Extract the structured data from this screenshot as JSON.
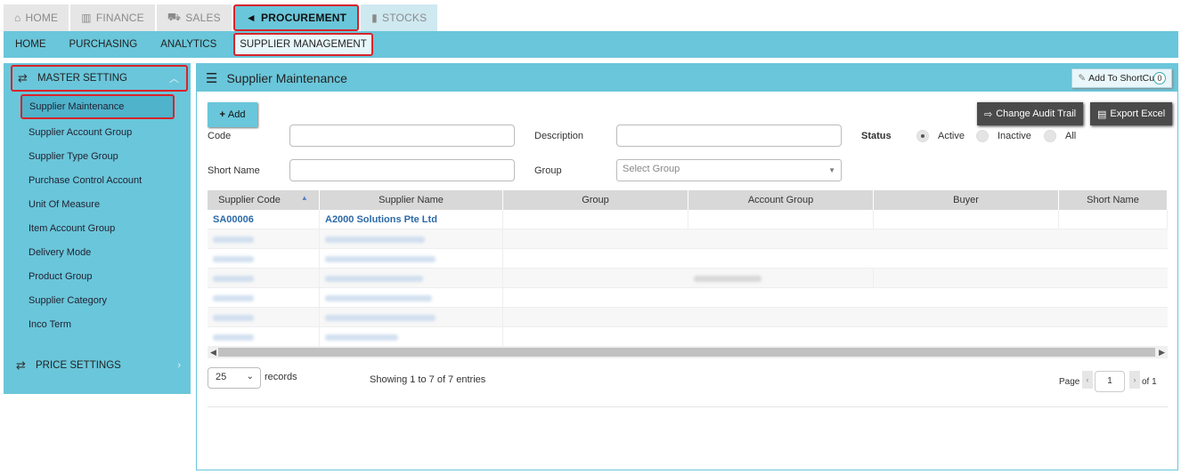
{
  "top_tabs": [
    {
      "label": "HOME",
      "icon": "home-icon",
      "glyph": "⌂"
    },
    {
      "label": "FINANCE",
      "icon": "bank-icon",
      "glyph": "🏛"
    },
    {
      "label": "SALES",
      "icon": "cart-icon",
      "glyph": "🛒"
    },
    {
      "label": "PROCUREMENT",
      "icon": "megaphone-icon",
      "glyph": "📢"
    },
    {
      "label": "STOCKS",
      "icon": "bar-chart-icon",
      "glyph": "▮"
    }
  ],
  "sub_nav": [
    "HOME",
    "PURCHASING",
    "ANALYTICS",
    "SUPPLIER MANAGEMENT"
  ],
  "sidebar": {
    "master_setting": "MASTER SETTING",
    "items": [
      "Supplier Maintenance",
      "Supplier Account Group",
      "Supplier Type Group",
      "Purchase Control Account",
      "Unit Of Measure",
      "Item Account Group",
      "Delivery Mode",
      "Product Group",
      "Supplier Category",
      "Inco Term"
    ],
    "price_settings": "PRICE SETTINGS"
  },
  "panel": {
    "title": "Supplier Maintenance",
    "shortcut_label": "Add To ShortCut",
    "shortcut_count": "0",
    "add_label": "Add",
    "audit_label": "Change Audit Trail",
    "export_label": "Export Excel"
  },
  "filters": {
    "code_label": "Code",
    "description_label": "Description",
    "status_label": "Status",
    "status_active": "Active",
    "status_inactive": "Inactive",
    "status_all": "All",
    "short_name_label": "Short Name",
    "group_label": "Group",
    "group_placeholder": "Select Group"
  },
  "table": {
    "columns": [
      "Supplier Code",
      "Supplier Name",
      "Group",
      "Account Group",
      "Buyer",
      "Short Name"
    ],
    "rows": [
      {
        "code": "SA00006",
        "name": "A2000 Solutions Pte Ltd"
      }
    ]
  },
  "footer": {
    "page_size": "25",
    "records_label": "records",
    "showing": "Showing 1 to 7 of 7 entries",
    "page_label": "Page",
    "page_value": "1",
    "of_label": "of 1"
  },
  "colors": {
    "accent": "#6ac6da",
    "highlight": "#d8232a",
    "link": "#2b6aa8"
  }
}
